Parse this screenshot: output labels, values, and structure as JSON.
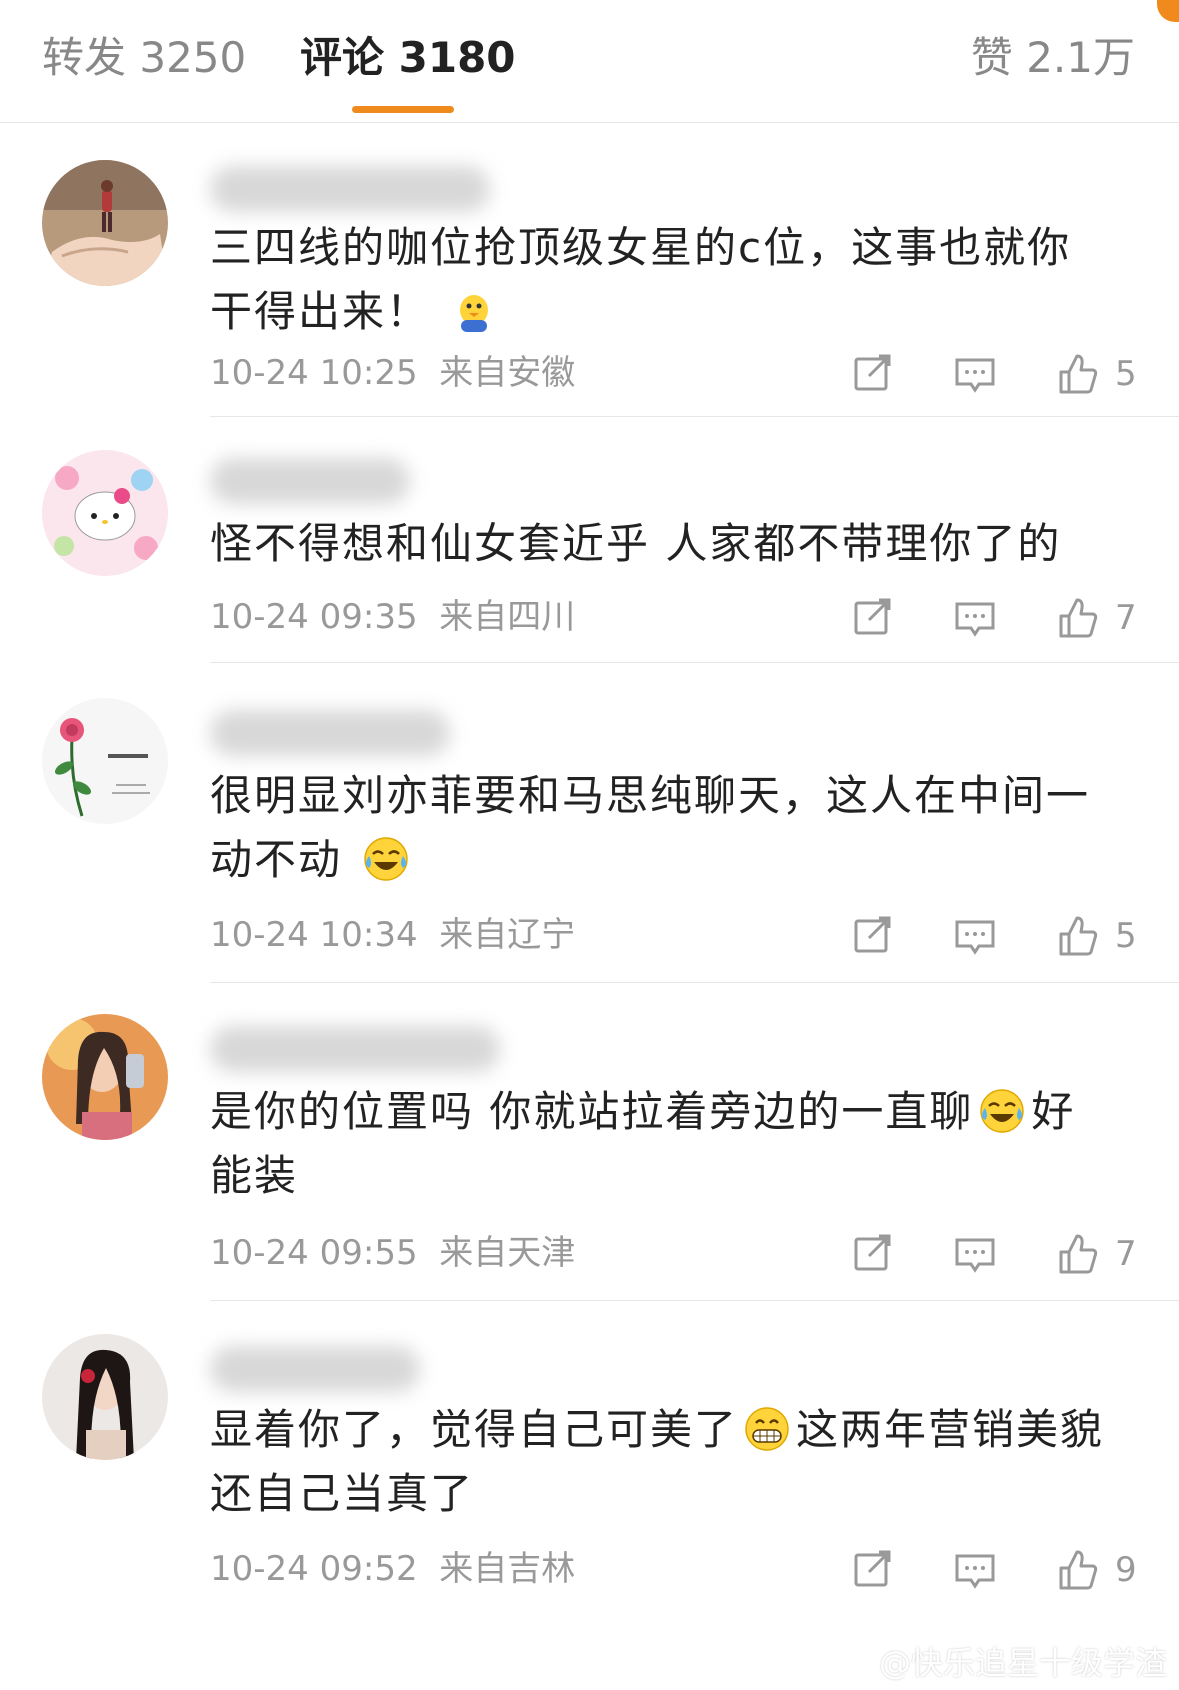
{
  "tabs": {
    "repost": "转发 3250",
    "comments": "评论 3180",
    "likes": "赞 2.1万"
  },
  "colors": {
    "accent": "#f08a1c",
    "meta_text": "#999999",
    "divider": "#e6e6e6"
  },
  "comments": [
    {
      "text": "三四线的咖位抢顶级女星的c位，这事也就你干得出来！",
      "time": "10-24 10:25",
      "location": "来自安徽",
      "likes": "5",
      "emoji": "chick-emoji"
    },
    {
      "text": "怪不得想和仙女套近乎  人家都不带理你了的",
      "time": "10-24 09:35",
      "location": "来自四川",
      "likes": "7"
    },
    {
      "text_a": "很明显刘亦菲要和马思纯聊天，这人在中间一动不动",
      "time": "10-24 10:34",
      "location": "来自辽宁",
      "likes": "5",
      "emoji": "laugh-cry-emoji"
    },
    {
      "text_a": "是你的位置吗 你就站拉着旁边的一直聊",
      "text_b": "好能装",
      "time": "10-24 09:55",
      "location": "来自天津",
      "likes": "7",
      "emoji": "laugh-cry-emoji"
    },
    {
      "text_a": "显着你了，觉得自己可美了",
      "text_b": "这两年营销美貌还自己当真了",
      "time": "10-24 09:52",
      "location": "来自吉林",
      "likes": "9",
      "emoji": "grin-emoji"
    }
  ],
  "watermark": "@快乐追星十级学渣"
}
